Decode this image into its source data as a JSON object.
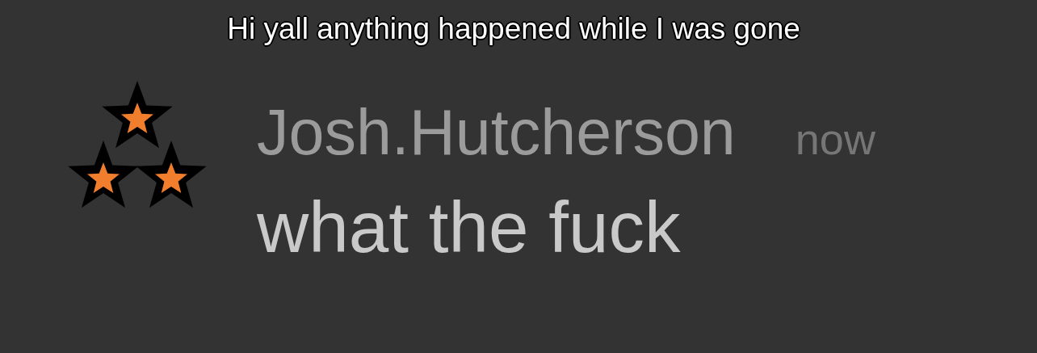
{
  "caption": "Hi yall anything happened while I was gone",
  "message": {
    "author": "Josh.Hutcherson",
    "time": "now",
    "text": "what the fuck"
  }
}
